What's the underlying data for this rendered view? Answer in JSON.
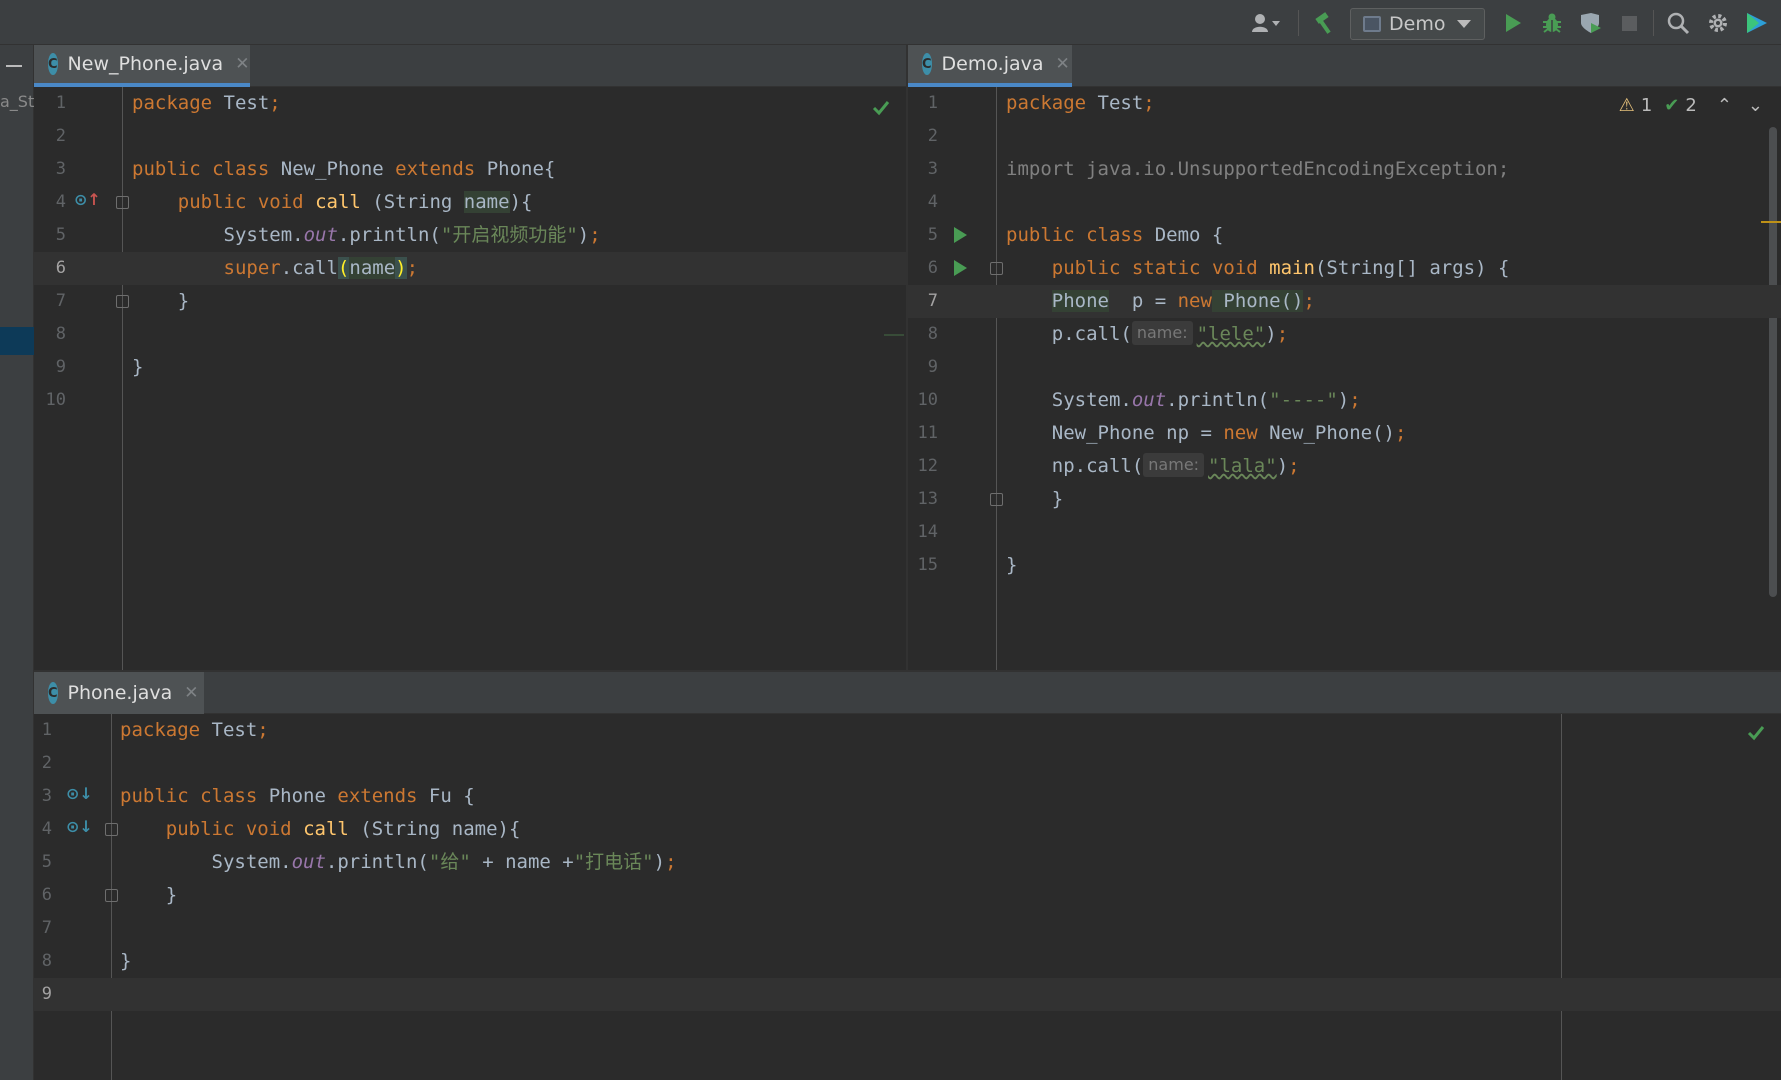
{
  "toolbar": {
    "run_config": "Demo",
    "accent_color": "#499c54"
  },
  "left_strip": {
    "label": "a_St"
  },
  "panes": {
    "new_phone": {
      "tab": "New_Phone.java",
      "lines": [
        "1",
        "2",
        "3",
        "4",
        "5",
        "6",
        "7",
        "8",
        "9",
        "10"
      ]
    },
    "demo": {
      "tab": "Demo.java",
      "warnings": "1",
      "weak_warnings": "2",
      "lines": [
        "1",
        "2",
        "3",
        "4",
        "5",
        "6",
        "7",
        "8",
        "9",
        "10",
        "11",
        "12",
        "13",
        "14",
        "15"
      ],
      "hint_label": "name:"
    },
    "phone": {
      "tab": "Phone.java",
      "lines": [
        "1",
        "2",
        "3",
        "4",
        "5",
        "6",
        "7",
        "8",
        "9"
      ]
    }
  },
  "code": {
    "np": {
      "l1_kw": "package",
      "l1_rest": " Test",
      "semi": ";",
      "l3_public": "public",
      "l3_class": "class",
      "l3_name": "New_Phone",
      "l3_extends": "extends",
      "l3_parent": "Phone{",
      "l4_public": "public",
      "l4_void": "void",
      "l4_call": "call",
      "l4_open": " (String ",
      "l4_param": "name",
      "l4_close": "){",
      "l5_sys": "System.",
      "l5_out": "out",
      "l5_print": ".println(",
      "l5_str": "\"开启视频功能\"",
      "l5_end": ")",
      "l6_super": "super",
      "l6_call": ".call",
      "l6_open": "(",
      "l6_name": "name",
      "l6_close": ")",
      "l7_brace": "}",
      "l9_brace": "}"
    },
    "demo": {
      "l1_kw": "package",
      "l1_rest": " Test",
      "semi": ";",
      "l3_import": "import java.io.UnsupportedEncodingException;",
      "l5_public": "public",
      "l5_class": "class",
      "l5_name": " Demo {",
      "l6_public": "public",
      "l6_static": "static",
      "l6_void": "void",
      "l6_main": "main",
      "l6_rest": "(String[] args) {",
      "l7_type": "Phone",
      "l7_var": "  p = ",
      "l7_new": "new",
      "l7_ctor": " Phone()",
      "l8_call": "p.call(",
      "l8_str": "\"lele\"",
      "l8_end": ")",
      "l10_sys": "System.",
      "l10_out": "out",
      "l10_print": ".println(",
      "l10_str": "\"----\"",
      "l10_end": ")",
      "l11_type": "New_Phone np = ",
      "l11_new": "new",
      "l11_ctor": " New_Phone()",
      "l12_call": "np.call(",
      "l12_str": "\"lala\"",
      "l12_end": ")",
      "l13_brace": "}",
      "l15_brace": "}"
    },
    "ph": {
      "l1_kw": "package",
      "l1_rest": " Test",
      "semi": ";",
      "l3_public": "public",
      "l3_class": "class",
      "l3_name": " Phone ",
      "l3_extends": "extends",
      "l3_parent": " Fu {",
      "l4_public": "public",
      "l4_void": "void",
      "l4_call": "call",
      "l4_rest": " (String name){",
      "l5_sys": "System.",
      "l5_out": "out",
      "l5_print": ".println(",
      "l5_str1": "\"给\"",
      "l5_mid": " + name +",
      "l5_str2": "\"打电话\"",
      "l5_end": ")",
      "l6_brace": "}",
      "l8_brace": "}"
    }
  }
}
